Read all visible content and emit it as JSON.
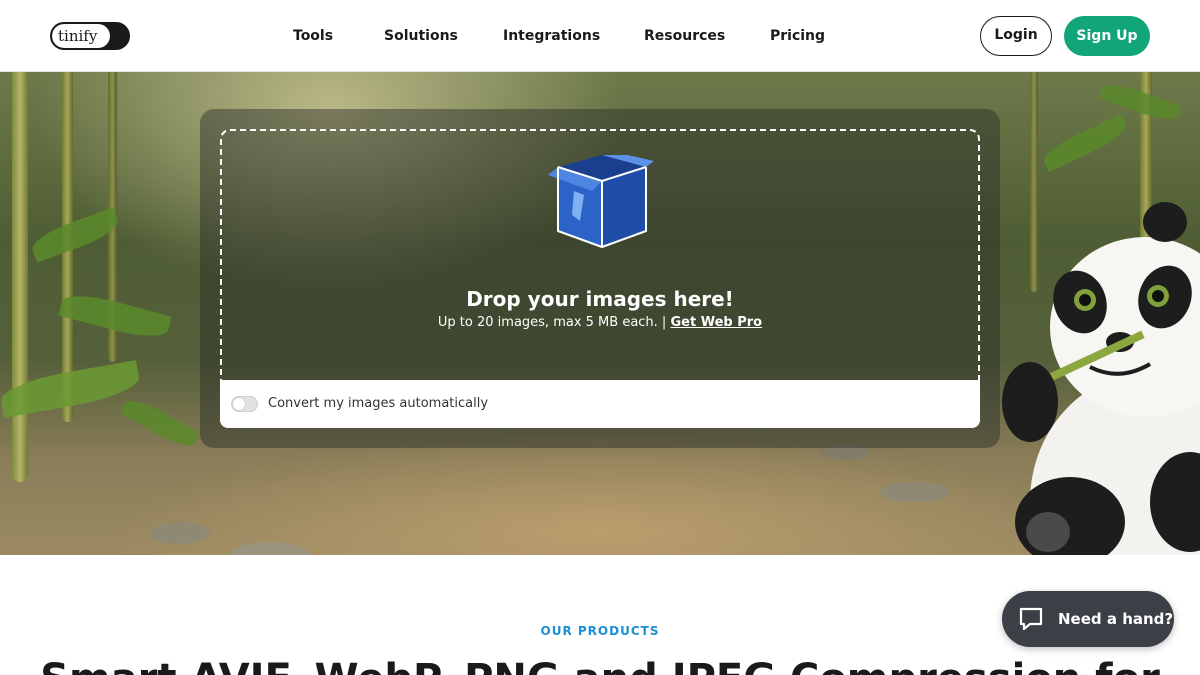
{
  "header": {
    "logo_text": "tinify",
    "nav": [
      {
        "label": "Tools"
      },
      {
        "label": "Solutions"
      },
      {
        "label": "Integrations"
      },
      {
        "label": "Resources"
      },
      {
        "label": "Pricing"
      }
    ],
    "login_label": "Login",
    "signup_label": "Sign Up"
  },
  "uploader": {
    "icon": "open-box-icon",
    "title": "Drop your images here!",
    "subtitle": "Up to 20 images, max 5 MB each. |",
    "link_label": "Get Web Pro",
    "convert_label": "Convert my images automatically",
    "convert_enabled": false
  },
  "products": {
    "eyebrow": "OUR PRODUCTS",
    "headline": "Smart AVIF, WebP, PNG and JPEG Compression for"
  },
  "help": {
    "icon": "chat-bubble-icon",
    "label": "Need a hand?"
  },
  "colors": {
    "accent": "#12a57a",
    "eyebrow": "#1a8fd6",
    "help_bg": "#3b4046"
  }
}
